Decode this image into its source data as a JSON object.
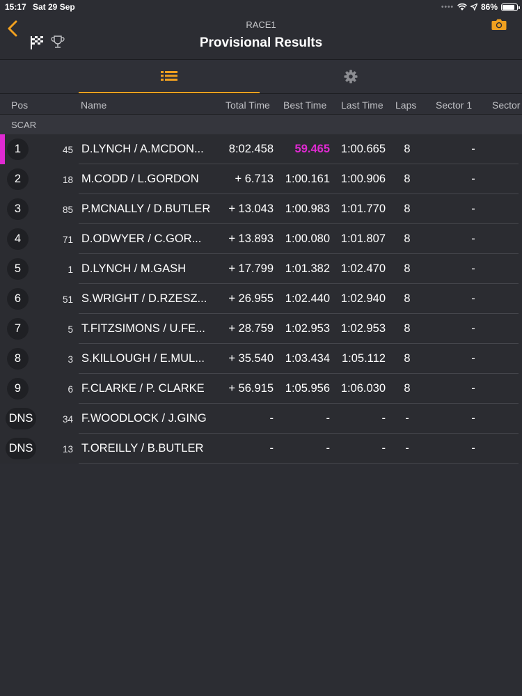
{
  "status_bar": {
    "time": "15:17",
    "date": "Sat 29 Sep",
    "signal": "••••",
    "battery": "86%",
    "battery_level": 0.86
  },
  "nav": {
    "subtitle": "RACE1",
    "title": "Provisional Results",
    "accent_color": "#f0a020"
  },
  "columns": {
    "pos": "Pos",
    "name": "Name",
    "total": "Total Time",
    "best": "Best Time",
    "last": "Last Time",
    "laps": "Laps",
    "sector1": "Sector 1",
    "sector2": "Sector"
  },
  "class_label": "SCAR",
  "highlight_color": "#e02ad2",
  "results": [
    {
      "pos": "1",
      "num": "45",
      "name": "D.LYNCH / A.MCDON...",
      "total": "8:02.458",
      "best": "59.465",
      "last": "1:00.665",
      "laps": "8",
      "s1": "-"
    },
    {
      "pos": "2",
      "num": "18",
      "name": "M.CODD / L.GORDON",
      "total": "+ 6.713",
      "best": "1:00.161",
      "last": "1:00.906",
      "laps": "8",
      "s1": "-"
    },
    {
      "pos": "3",
      "num": "85",
      "name": "P.MCNALLY / D.BUTLER",
      "total": "+ 13.043",
      "best": "1:00.983",
      "last": "1:01.770",
      "laps": "8",
      "s1": "-"
    },
    {
      "pos": "4",
      "num": "71",
      "name": "D.ODWYER / C.GOR...",
      "total": "+ 13.893",
      "best": "1:00.080",
      "last": "1:01.807",
      "laps": "8",
      "s1": "-"
    },
    {
      "pos": "5",
      "num": "1",
      "name": "D.LYNCH / M.GASH",
      "total": "+ 17.799",
      "best": "1:01.382",
      "last": "1:02.470",
      "laps": "8",
      "s1": "-"
    },
    {
      "pos": "6",
      "num": "51",
      "name": "S.WRIGHT / D.RZESZ...",
      "total": "+ 26.955",
      "best": "1:02.440",
      "last": "1:02.940",
      "laps": "8",
      "s1": "-"
    },
    {
      "pos": "7",
      "num": "5",
      "name": "T.FITZSIMONS / U.FE...",
      "total": "+ 28.759",
      "best": "1:02.953",
      "last": "1:02.953",
      "laps": "8",
      "s1": "-"
    },
    {
      "pos": "8",
      "num": "3",
      "name": "S.KILLOUGH / E.MUL...",
      "total": "+ 35.540",
      "best": "1:03.434",
      "last": "1:05.112",
      "laps": "8",
      "s1": "-"
    },
    {
      "pos": "9",
      "num": "6",
      "name": "F.CLARKE / P. CLARKE",
      "total": "+ 56.915",
      "best": "1:05.956",
      "last": "1:06.030",
      "laps": "8",
      "s1": "-"
    },
    {
      "pos": "DNS",
      "num": "34",
      "name": "F.WOODLOCK / J.GING",
      "total": "-",
      "best": "-",
      "last": "-",
      "laps": "-",
      "s1": "-"
    },
    {
      "pos": "DNS",
      "num": "13",
      "name": "T.OREILLY / B.BUTLER",
      "total": "-",
      "best": "-",
      "last": "-",
      "laps": "-",
      "s1": "-"
    }
  ]
}
